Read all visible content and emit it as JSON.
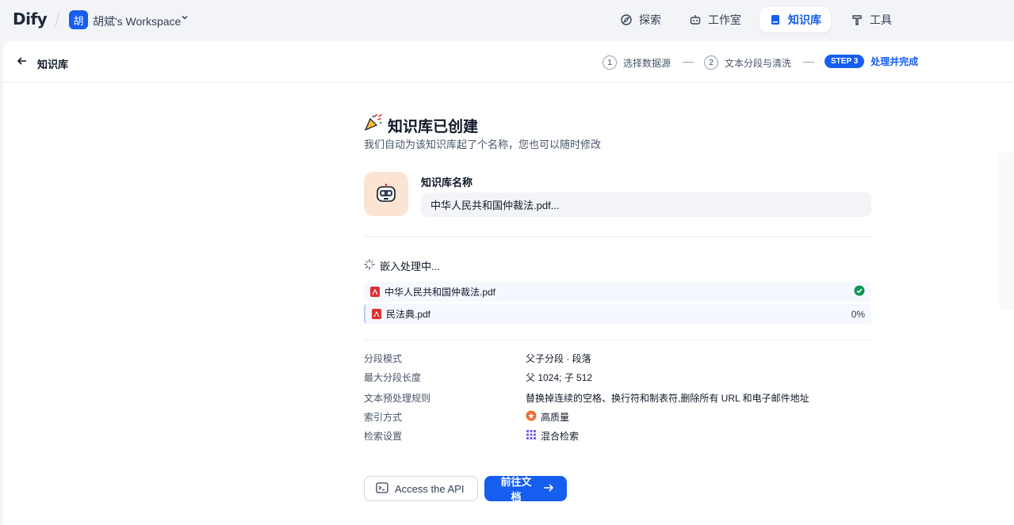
{
  "header": {
    "logo": "Dify",
    "workspace": {
      "avatar": "胡",
      "name": "胡斌's Workspace"
    },
    "nav": [
      {
        "label": "探索",
        "icon": "compass-icon"
      },
      {
        "label": "工作室",
        "icon": "robot-icon"
      },
      {
        "label": "知识库",
        "icon": "book-icon",
        "active": true
      },
      {
        "label": "工具",
        "icon": "hammer-icon"
      }
    ]
  },
  "page": {
    "title": "知识库",
    "steps": [
      {
        "num": "1",
        "label": "选择数据源"
      },
      {
        "num": "2",
        "label": "文本分段与清洗"
      },
      {
        "num": "STEP 3",
        "label": "处理并完成",
        "active": true
      }
    ]
  },
  "result": {
    "title": "知识库已创建",
    "subtitle": "我们自动为该知识库起了个名称，您也可以随时修改",
    "name_label": "知识库名称",
    "name_value": "中华人民共和国仲裁法.pdf...",
    "embedding_status": "嵌入处理中...",
    "files": [
      {
        "name": "中华人民共和国仲裁法.pdf",
        "status": "done"
      },
      {
        "name": "民法典.pdf",
        "status": "0%"
      }
    ],
    "meta": [
      {
        "key": "分段模式",
        "value": "父子分段 · 段落"
      },
      {
        "key": "最大分段长度",
        "value": "父 1024; 子 512"
      },
      {
        "key": "文本预处理规则",
        "value": "替换掉连续的空格、换行符和制表符,删除所有 URL 和电子邮件地址"
      },
      {
        "key": "索引方式",
        "value": "高质量",
        "icon": "star-badge-icon"
      },
      {
        "key": "检索设置",
        "value": "混合检索",
        "icon": "grid-icon"
      }
    ],
    "buttons": {
      "api": "Access the API",
      "go": "前往文档"
    }
  },
  "colors": {
    "primary": "#155eef",
    "success": "#079455",
    "pdf": "#e02e2e",
    "quality": "#f2692e",
    "hybrid": "#7a5af8"
  }
}
